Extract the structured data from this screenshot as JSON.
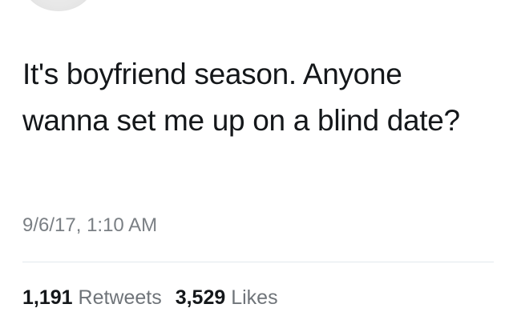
{
  "tweet": {
    "text": "It's boyfriend season. Anyone wanna set me up on a blind date?",
    "timestamp": "9/6/17, 1:10 AM"
  },
  "stats": {
    "retweets_count": "1,191",
    "retweets_label": "Retweets",
    "likes_count": "3,529",
    "likes_label": "Likes"
  }
}
